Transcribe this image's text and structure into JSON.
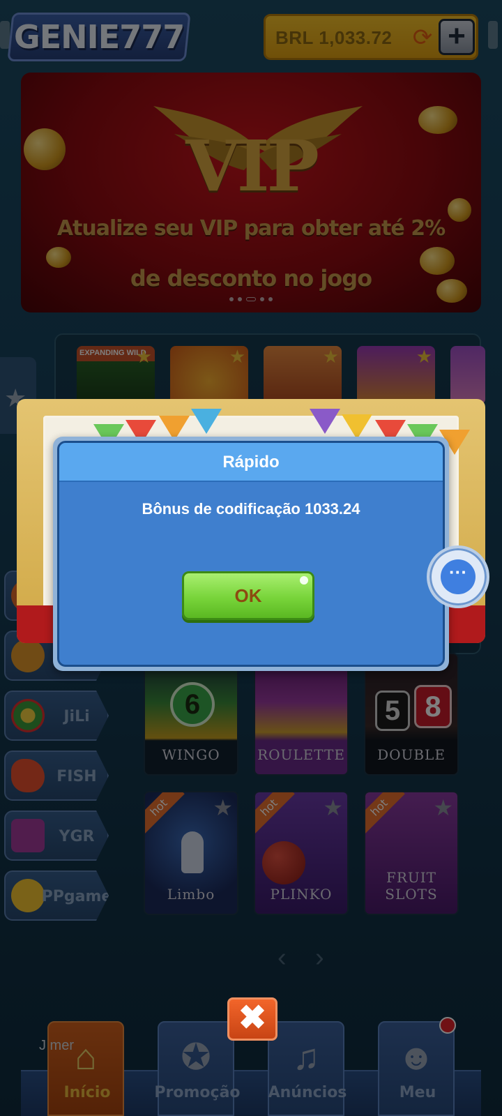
{
  "header": {
    "logo_text": "GENIE777",
    "balance": "BRL 1,033.72"
  },
  "banner": {
    "headline": "VIP",
    "line1": "Atualize seu VIP para obter até 2%",
    "line2": "de desconto no jogo",
    "slide_count": 5,
    "active_slide": 3
  },
  "thumbs": [
    {
      "tag": "EXPANDING WILD"
    }
  ],
  "categories": [
    {
      "label": "JiLi",
      "icon": "jili-icon"
    },
    {
      "label": "FISH",
      "icon": "fish-icon"
    },
    {
      "label": "YGR",
      "icon": "hammer-icon"
    },
    {
      "label": "PPgame",
      "icon": "sun-icon"
    }
  ],
  "games_row1": [
    {
      "label": "WINGO",
      "number": "6"
    },
    {
      "label": "ROULETTE"
    },
    {
      "label": "DOUBLE",
      "numbers": [
        "5",
        "8"
      ]
    }
  ],
  "games_row2": [
    {
      "label": "Limbo",
      "tag": "hot"
    },
    {
      "label": "PLINKO",
      "tag": "hot"
    },
    {
      "label": "FRUIT SLOTS",
      "tag": "hot"
    }
  ],
  "dialog": {
    "title": "Rápido",
    "message": "Bônus de codificação 1033.24",
    "ok_label": "OK"
  },
  "ticker": "J          mer",
  "nav": [
    {
      "label": "Início",
      "icon": "home-icon",
      "active": true
    },
    {
      "label": "Promoção",
      "icon": "medal-icon",
      "active": false
    },
    {
      "label": "Anúncios",
      "icon": "bell-icon",
      "active": false
    },
    {
      "label": "Meu",
      "icon": "user-icon",
      "active": false,
      "badge": true
    }
  ],
  "colors": {
    "dialog_bg": "#3f7fce",
    "ok_button": "#78d43a",
    "balance_bg": "#f6c22a",
    "nav_active": "#d2611d"
  }
}
